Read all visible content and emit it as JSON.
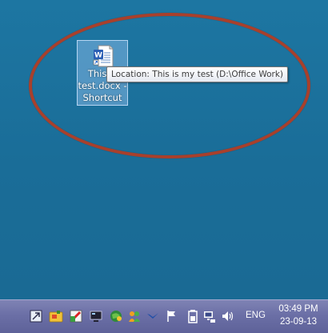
{
  "desktop": {
    "background_color": "#1b6e99",
    "annotation_color": "#a8402c",
    "shortcut": {
      "label": "This is my test.docx - Shortcut",
      "label_visible_line1": "This is",
      "label_line2": "test.docx -",
      "label_line3": "Shortcut",
      "icon": "word-document-icon"
    },
    "tooltip": {
      "text": "Location: This is my test (D:\\Office Work)"
    }
  },
  "taskbar": {
    "tray_icons": [
      "show-hidden-icons-icon",
      "folder-notes-icon",
      "security-alert-icon",
      "monitor-icon",
      "network-globe-icon",
      "messenger-icon",
      "bird-icon",
      "action-center-flag-icon",
      "battery-icon",
      "network-icon",
      "volume-icon"
    ],
    "language": "ENG",
    "clock": {
      "time": "03:49 PM",
      "date": "23-09-13"
    }
  }
}
